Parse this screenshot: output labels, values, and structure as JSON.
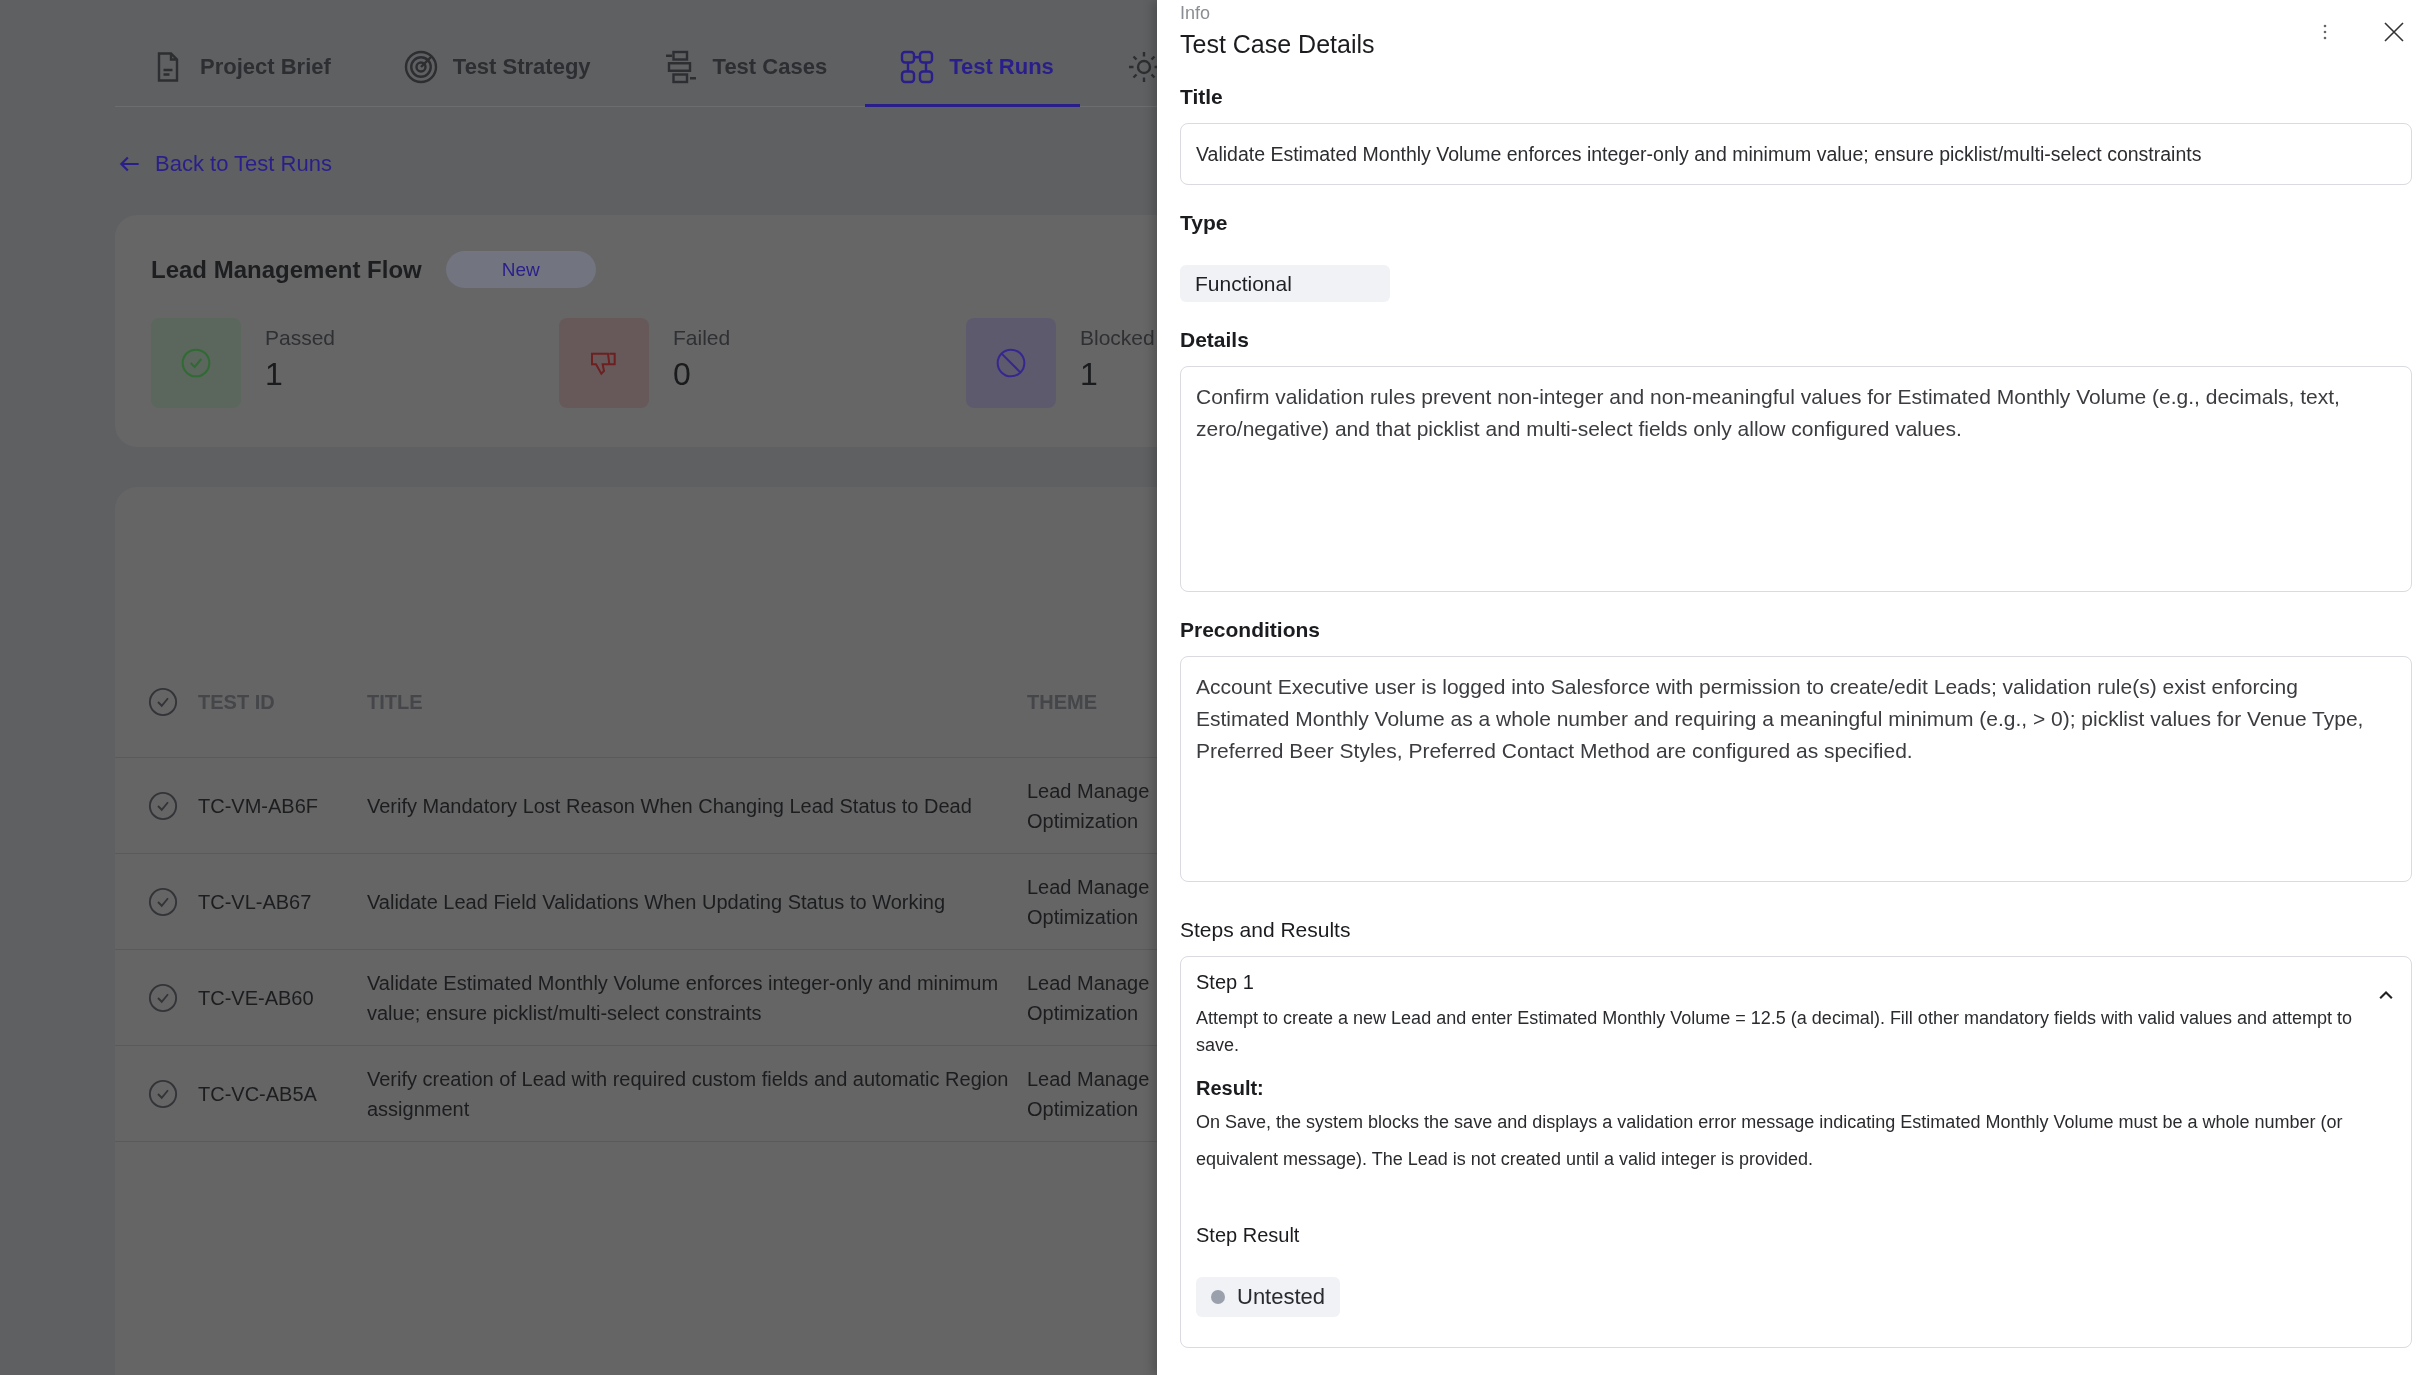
{
  "tabs": [
    {
      "label": "Project Brief",
      "selected": false
    },
    {
      "label": "Test Strategy",
      "selected": false
    },
    {
      "label": "Test Cases",
      "selected": false
    },
    {
      "label": "Test Runs",
      "selected": true
    },
    {
      "selected": false
    }
  ],
  "back_link": "Back to Test Runs",
  "run": {
    "title": "Lead Management Flow",
    "status": "New",
    "stats": [
      {
        "label": "Passed",
        "value": "1",
        "color": "#2f6b33"
      },
      {
        "label": "Failed",
        "value": "0",
        "color": "#6e1f1f"
      },
      {
        "label": "Blocked",
        "value": "1",
        "color": "#35278f"
      }
    ]
  },
  "table": {
    "columns": [
      "TEST ID",
      "TITLE",
      "THEME"
    ],
    "rows": [
      {
        "test_id": "TC-VM-AB6F",
        "title": "Verify Mandatory Lost Reason When Changing Lead Status to Dead",
        "theme": "Lead Manage\nOptimization"
      },
      {
        "test_id": "TC-VL-AB67",
        "title": "Validate Lead Field Validations When Updating Status to Working",
        "theme": "Lead Manage\nOptimization"
      },
      {
        "test_id": "TC-VE-AB60",
        "title": "Validate Estimated Monthly Volume enforces integer-only and minimum value; ensure picklist/multi-select constraints",
        "theme": "Lead Manage\nOptimization"
      },
      {
        "test_id": "TC-VC-AB5A",
        "title": "Verify creation of Lead with required custom fields and automatic Region assignment",
        "theme": "Lead Manage\nOptimization"
      }
    ]
  },
  "panel": {
    "eyebrow": "Info",
    "title": "Test Case Details",
    "fields": [
      {
        "kind": "input",
        "label": "Title",
        "value": "Validate Estimated Monthly Volume enforces integer-only and minimum value; ensure picklist/multi-select constraints"
      },
      {
        "kind": "chip",
        "label": "Type",
        "value": "Functional"
      },
      {
        "kind": "textarea",
        "label": "Details",
        "value": "Confirm validation rules prevent non-integer and non-meaningful values for Estimated Monthly Volume (e.g., decimals, text, zero/negative) and that picklist and multi-select fields only allow configured values."
      },
      {
        "kind": "textarea",
        "label": "Preconditions",
        "value": "Account Executive user is logged into Salesforce with permission to create/edit Leads; validation rule(s) exist enforcing Estimated Monthly Volume as a whole number and requiring a meaningful minimum (e.g., > 0); picklist values for Venue Type, Preferred Beer Styles, Preferred Contact Method are configured as specified."
      }
    ],
    "steps_heading": "Steps and Results",
    "steps": [
      {
        "title": "Step 1",
        "expanded": true,
        "action": "Attempt to create a new Lead and enter Estimated Monthly Volume = 12.5 (a decimal). Fill other mandatory fields with valid values and attempt to save.",
        "result_label": "Result:",
        "result": "On Save, the system blocks the save and displays a validation error message indicating Estimated Monthly Volume must be a whole number (or equivalent message). The Lead is not created until a valid integer is provided.",
        "step_result_label": "Step Result",
        "status": "Untested",
        "color": "#9aa0ac"
      }
    ]
  }
}
